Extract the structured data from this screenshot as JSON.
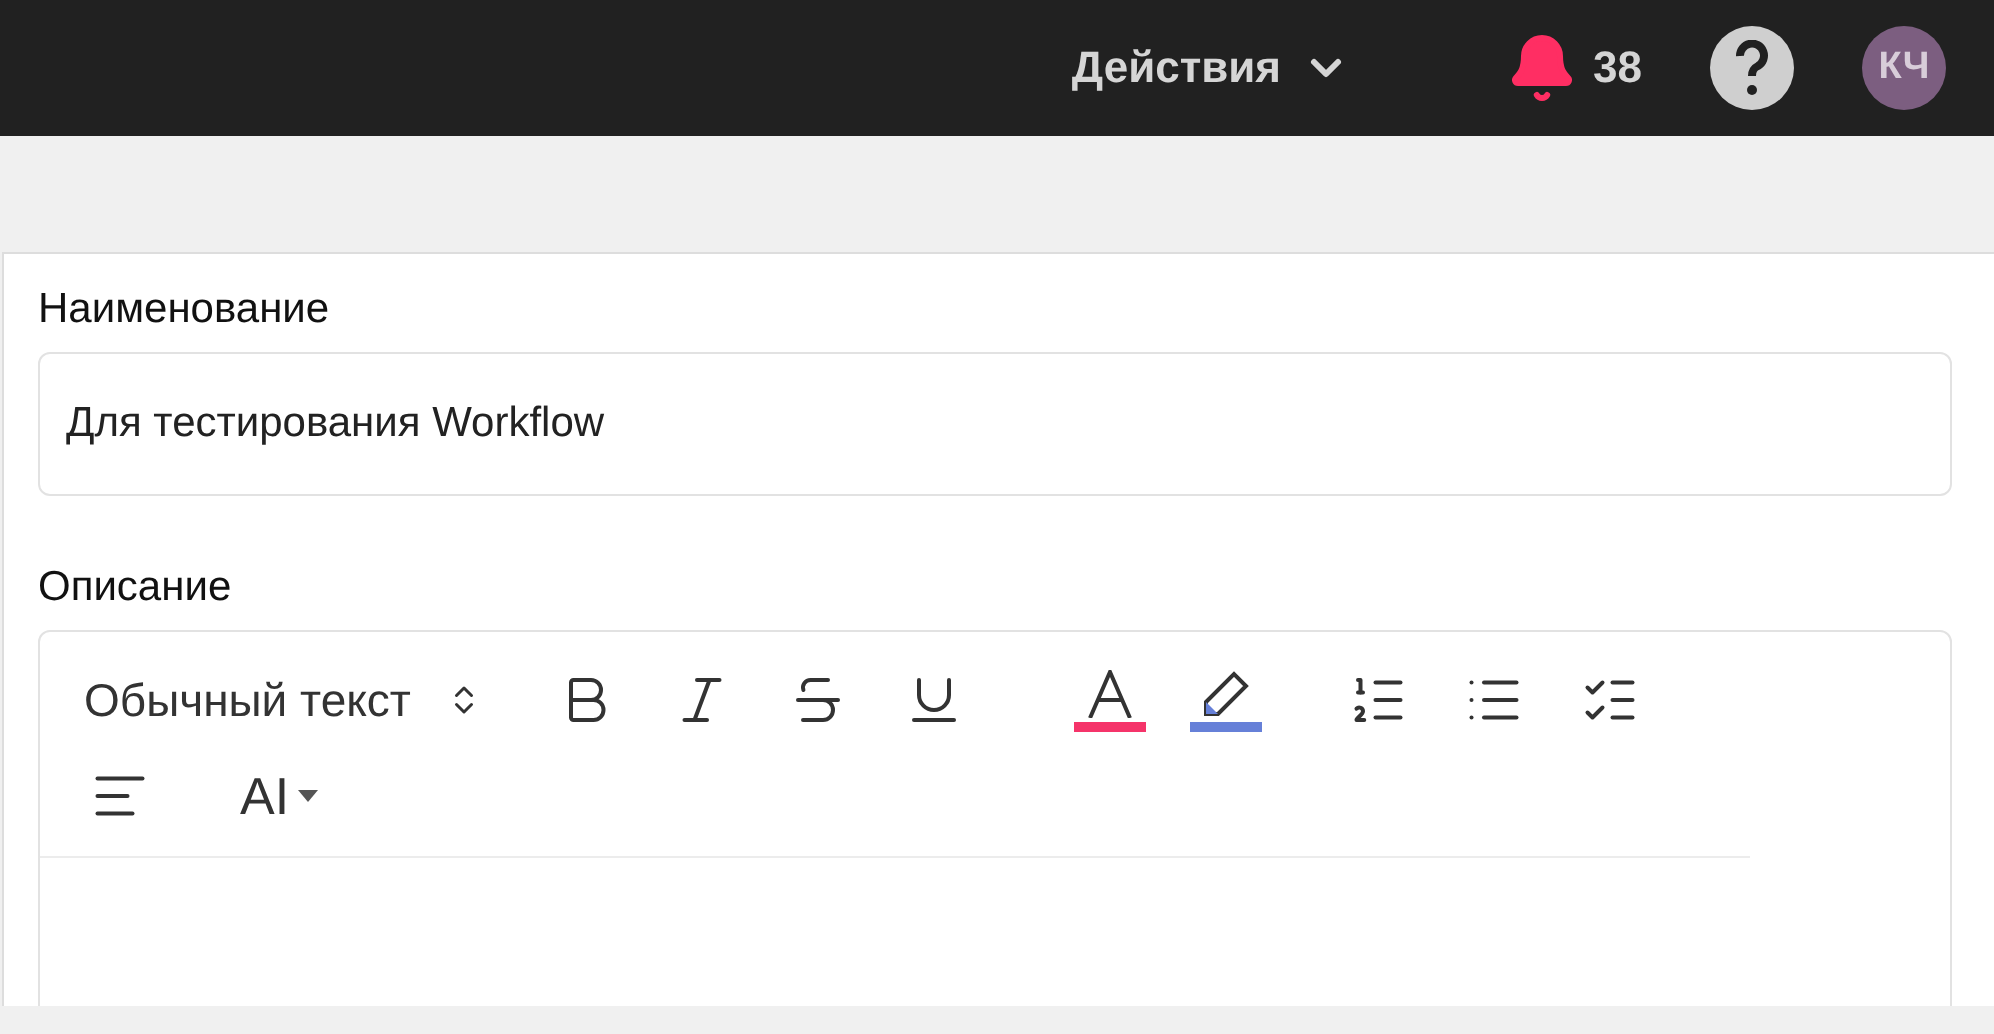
{
  "header": {
    "actions_menu": "Действия",
    "notifications_count": "38",
    "avatar_initials": "КЧ"
  },
  "form": {
    "name_label": "Наименование",
    "name_value": "Для тестирования Workflow",
    "description_label": "Описание",
    "editor": {
      "text_style": "Обычный текст",
      "tools": [
        {
          "kind": "bold"
        },
        {
          "kind": "italic"
        },
        {
          "kind": "strike"
        },
        {
          "kind": "underline"
        },
        {
          "kind": "text-color",
          "color": "#f5346a"
        },
        {
          "kind": "highlight",
          "color": "#6680d8"
        },
        {
          "kind": "numbered-list"
        },
        {
          "kind": "bullet-list"
        },
        {
          "kind": "check-list"
        },
        {
          "kind": "align-left"
        }
      ],
      "ai_label": "AI"
    }
  }
}
